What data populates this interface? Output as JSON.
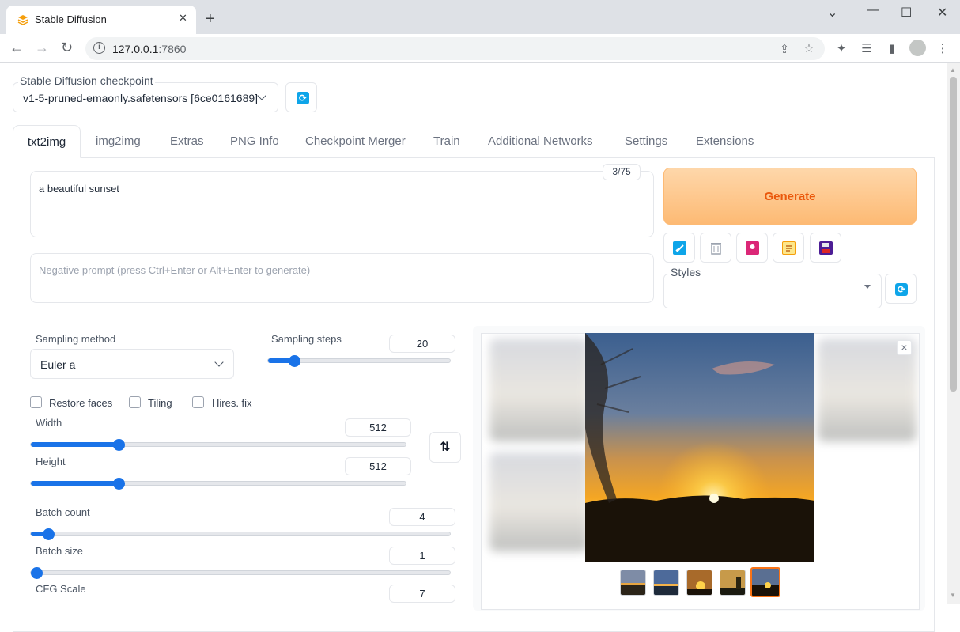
{
  "browser": {
    "tab_title": "Stable Diffusion",
    "url_host": "127.0.0.1",
    "url_port": ":7860",
    "window_controls": [
      "chevron-down",
      "minimize",
      "maximize",
      "close"
    ]
  },
  "checkpoint": {
    "label": "Stable Diffusion checkpoint",
    "value": "v1-5-pruned-emaonly.safetensors [6ce0161689]"
  },
  "tabs": [
    "txt2img",
    "img2img",
    "Extras",
    "PNG Info",
    "Checkpoint Merger",
    "Train",
    "Additional Networks",
    "Settings",
    "Extensions"
  ],
  "prompt": {
    "value": "a beautiful sunset",
    "token_count": "3/75",
    "negative_placeholder": "Negative prompt (press Ctrl+Enter or Alt+Enter to generate)"
  },
  "generate": {
    "label": "Generate"
  },
  "tool_buttons": [
    "read-params-icon",
    "trash-icon",
    "show-extra-networks-icon",
    "clipboard-icon",
    "save-style-icon"
  ],
  "styles": {
    "label": "Styles",
    "value": ""
  },
  "sampling": {
    "method_label": "Sampling method",
    "method_value": "Euler a",
    "steps_label": "Sampling steps",
    "steps_value": "20",
    "steps_fraction": 0.13
  },
  "options": {
    "restore_faces": {
      "label": "Restore faces",
      "checked": false
    },
    "tiling": {
      "label": "Tiling",
      "checked": false
    },
    "hires_fix": {
      "label": "Hires. fix",
      "checked": false
    }
  },
  "dimensions": {
    "width_label": "Width",
    "width_value": "512",
    "height_label": "Height",
    "height_value": "512",
    "swap_label": "⇅"
  },
  "batch": {
    "count_label": "Batch count",
    "count_value": "4",
    "size_label": "Batch size",
    "size_value": "1"
  },
  "cfg": {
    "label": "CFG Scale",
    "value": "7"
  },
  "gallery": {
    "close_label": "×",
    "thumbnail_count": 5,
    "selected_index": 4
  },
  "colors": {
    "accent": "#1a73e8",
    "generate_bg": "#fdba74",
    "generate_text": "#ea580c"
  }
}
